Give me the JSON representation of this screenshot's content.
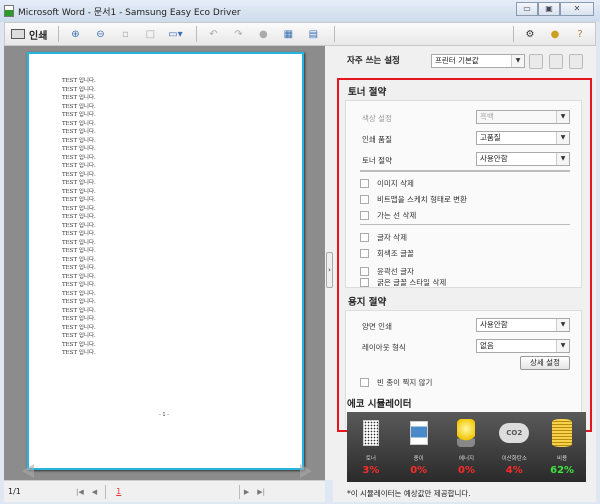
{
  "window": {
    "title": "Microsoft Word - 문서1 - Samsung Easy Eco Driver",
    "minimize": "▭",
    "maximize": "▣",
    "close": "✕"
  },
  "toolbar": {
    "print_label": "인쇄"
  },
  "document": {
    "lines": [
      "TEST 입니다.",
      "TEST 입니다.",
      "TEST 입니다.",
      "TEST 입니다.",
      "TEST 입니다.",
      "TEST 입니다.",
      "TEST 입니다.",
      "TEST 입니다.",
      "TEST 입니다.",
      "TEST 입니다.",
      "TEST 입니다.",
      "TEST 입니다.",
      "TEST 입니다.",
      "TEST 입니다.",
      "TEST 입니다.",
      "TEST 입니다.",
      "TEST 입니다.",
      "TEST 입니다.",
      "TEST 입니다.",
      "TEST 입니다.",
      "TEST 입니다.",
      "TEST 입니다.",
      "TEST 입니다.",
      "TEST 입니다.",
      "TEST 입니다.",
      "TEST 입니다.",
      "TEST 입니다.",
      "TEST 입니다.",
      "TEST 입니다.",
      "TEST 입니다.",
      "TEST 입니다.",
      "TEST 입니다.",
      "TEST 입니다."
    ],
    "page_number": "- 1 -"
  },
  "status": {
    "page_count": "1/1",
    "current_page": "1"
  },
  "settings": {
    "favorites_label": "자주 쓰는 설정",
    "favorites_value": "프린터 기본값"
  },
  "toner": {
    "title": "토너 절약",
    "color_label": "색상 설정",
    "color_value": "흑백",
    "quality_label": "인쇄 품질",
    "quality_value": "고품질",
    "toner_label": "토너 절약",
    "toner_value": "사용안함",
    "checks1": [
      "이미지 삭제",
      "비트맵을 스케치 형태로 변환",
      "가는 선 삭제"
    ],
    "checks2": [
      "글자 삭제",
      "회색조 글꼴",
      "윤곽선 글자",
      "굵은 글꼴 스타일 삭제"
    ]
  },
  "paper": {
    "title": "용지 절약",
    "duplex_label": "양면 인쇄",
    "duplex_value": "사용안함",
    "layout_label": "레이아웃 형식",
    "layout_value": "없음",
    "detail_button": "상세 설정",
    "skip_blank": "빈 종이 찍지 않기"
  },
  "eco": {
    "title": "에코 시뮬레이터",
    "items": [
      {
        "name": "토너",
        "value": "3%",
        "color": "#ff2a2a"
      },
      {
        "name": "종이",
        "value": "0%",
        "color": "#ff2a2a"
      },
      {
        "name": "에너지",
        "value": "0%",
        "color": "#ff2a2a"
      },
      {
        "name": "이산화탄소",
        "value": "4%",
        "color": "#ff2a2a"
      },
      {
        "name": "비용",
        "value": "62%",
        "color": "#3fe23f"
      }
    ],
    "co2_text": "CO2",
    "note": "*이 시뮬레이터는 예상값만 제공합니다."
  }
}
